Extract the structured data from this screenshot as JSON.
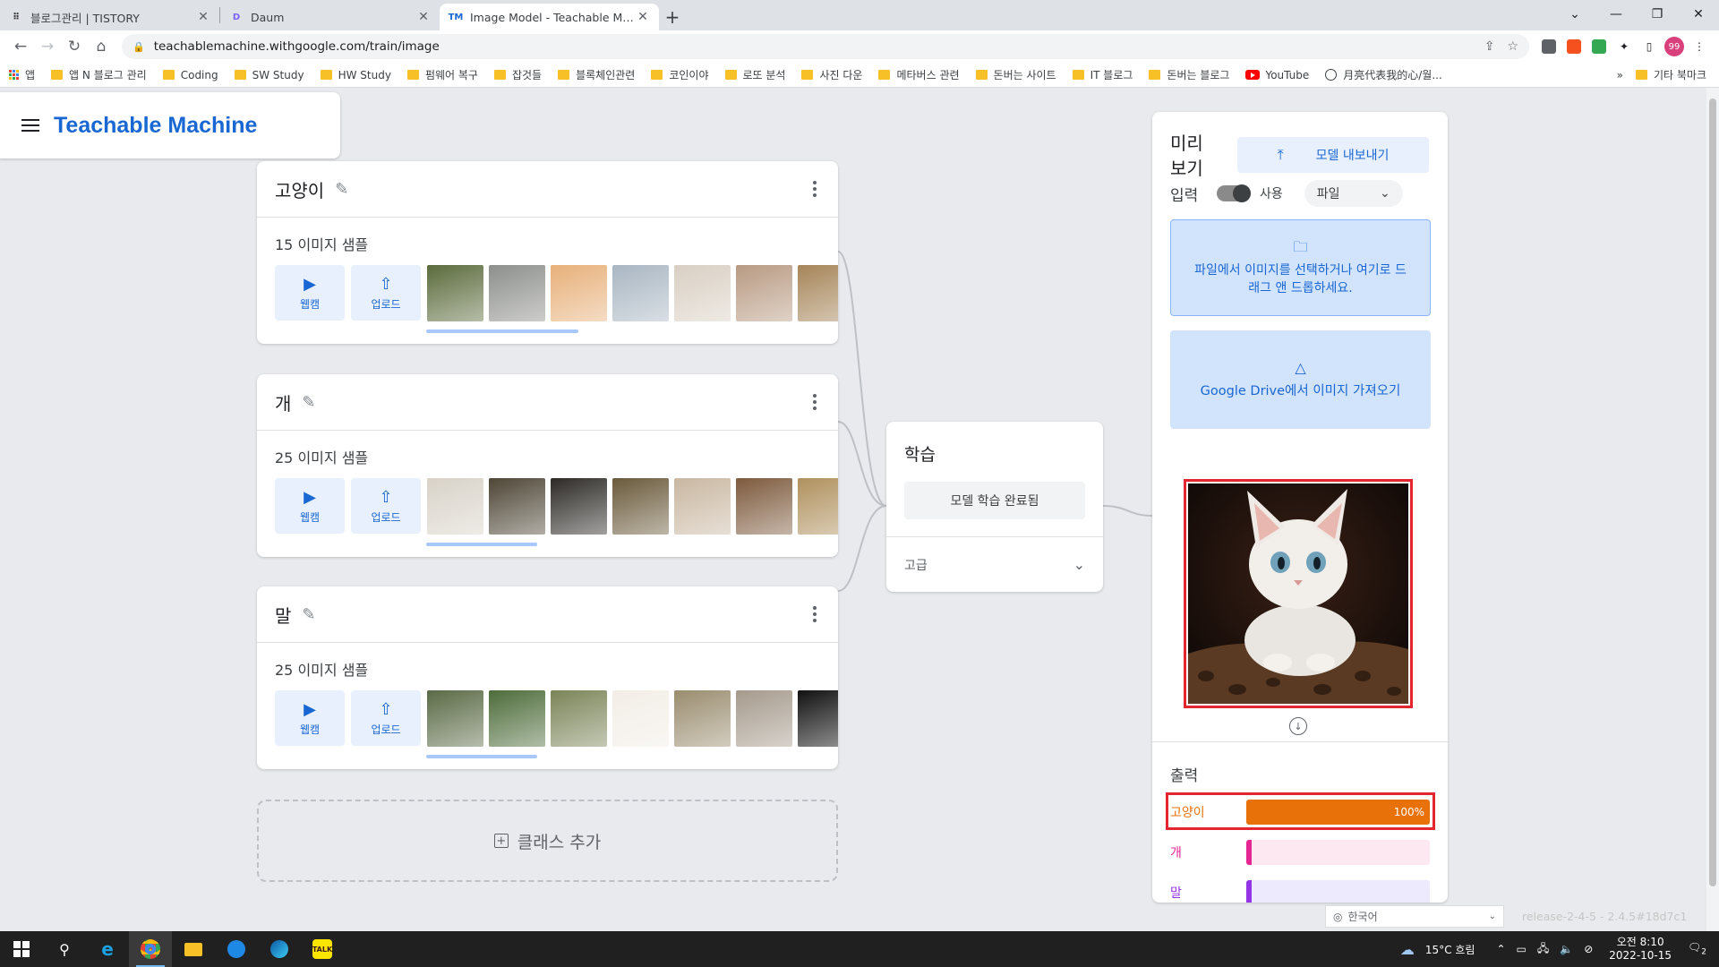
{
  "browser": {
    "tabs": [
      {
        "title": "블로그관리 | TISTORY",
        "favicon": "T",
        "favicon_color": "#333333",
        "active": false
      },
      {
        "title": "Daum",
        "favicon": "D",
        "favicon_color": "#7b61ff",
        "active": false
      },
      {
        "title": "Image Model - Teachable Machine",
        "favicon": "TM",
        "favicon_color": "#1967d2",
        "active": true
      }
    ],
    "new_tab_label": "+",
    "url": "teachablemachine.withgoogle.com/train/image",
    "bookmarks": [
      {
        "label": "앱",
        "kind": "apps"
      },
      {
        "label": "앱 N 블로그 관리",
        "kind": "folder"
      },
      {
        "label": "Coding",
        "kind": "folder"
      },
      {
        "label": "SW Study",
        "kind": "folder"
      },
      {
        "label": "HW Study",
        "kind": "folder"
      },
      {
        "label": "펌웨어 복구",
        "kind": "folder"
      },
      {
        "label": "잡것들",
        "kind": "folder"
      },
      {
        "label": "블록체인관련",
        "kind": "folder"
      },
      {
        "label": "코인이야",
        "kind": "folder"
      },
      {
        "label": "로또 분석",
        "kind": "folder"
      },
      {
        "label": "사진 다운",
        "kind": "folder"
      },
      {
        "label": "메타버스 관련",
        "kind": "folder"
      },
      {
        "label": "돈버는 사이트",
        "kind": "folder"
      },
      {
        "label": "IT 블로그",
        "kind": "folder"
      },
      {
        "label": "돈버는 블로그",
        "kind": "folder"
      },
      {
        "label": "YouTube",
        "kind": "youtube"
      },
      {
        "label": "月亮代表我的心/월...",
        "kind": "globe"
      }
    ],
    "bookmarks_overflow": "»",
    "other_bookmarks": "기타 북마크",
    "profile_initials": "99"
  },
  "app": {
    "title": "Teachable Machine"
  },
  "classes": [
    {
      "name": "고양이",
      "count": "15",
      "samples_label": "이미지 샘플",
      "thumb_colors": [
        "#5b6b3c",
        "#8d8f8c",
        "#e7b07a",
        "#a9b6c2",
        "#d9cfc3",
        "#b89a82",
        "#a68559"
      ]
    },
    {
      "name": "개",
      "count": "25",
      "samples_label": "이미지 샘플",
      "thumb_colors": [
        "#d8d2c8",
        "#4e4636",
        "#2d2a26",
        "#6a5a3b",
        "#c9b7a1",
        "#7d5a3d",
        "#b0915e"
      ]
    },
    {
      "name": "말",
      "count": "25",
      "samples_label": "이미지 샘플",
      "thumb_colors": [
        "#5a6a45",
        "#4d6c3a",
        "#7b8458",
        "#f2ede6",
        "#9a8d6f",
        "#a59a8c",
        "#111111"
      ]
    }
  ],
  "class_buttons": {
    "webcam": "웹캠",
    "upload": "업로드"
  },
  "add_class": "클래스 추가",
  "training": {
    "title": "학습",
    "button": "모델 학습 완료됨",
    "advanced": "고급"
  },
  "preview": {
    "title": "미리 보기",
    "export_button": "모델 내보내기",
    "input_label": "입력",
    "toggle_label": "사용",
    "source_select": "파일",
    "dropzone_text": "파일에서 이미지를 선택하거나 여기로 드래그 앤 드롭하세요.",
    "drive_text": "Google Drive에서 이미지 가져오기",
    "output_label": "출력",
    "outputs": [
      {
        "name": "고양이",
        "percent": 100,
        "percent_label": "100%",
        "color": "#e8710a",
        "track": "#fce8d6",
        "text_color": "#e8710a"
      },
      {
        "name": "개",
        "percent": 0,
        "percent_label": "",
        "color": "#e52592",
        "track": "#fde7f0",
        "text_color": "#e52592"
      },
      {
        "name": "말",
        "percent": 0,
        "percent_label": "",
        "color": "#9334e6",
        "track": "#eeeafd",
        "text_color": "#9334e6"
      }
    ]
  },
  "footer": {
    "language": "한국어",
    "release": "release-2-4-5 - 2.4.5#18d7c1"
  },
  "taskbar": {
    "weather": "15°C 흐림",
    "time": "오전 8:10",
    "date": "2022-10-15",
    "notification_count": "2"
  }
}
